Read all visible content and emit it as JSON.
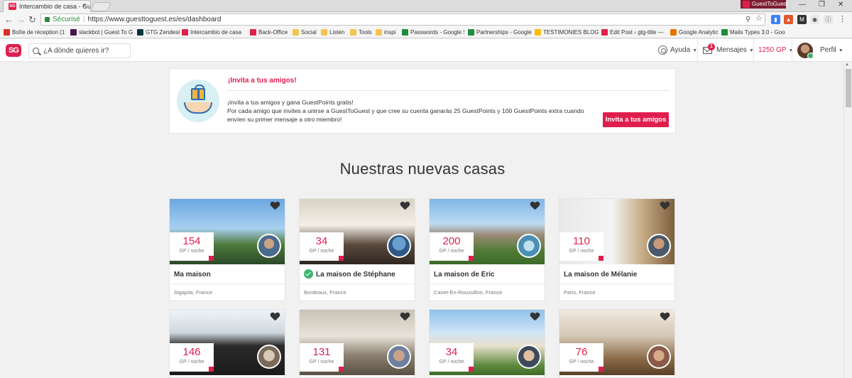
{
  "browser": {
    "tab_title": "Intercambio de casa - Gu",
    "tab_favicon": "SG",
    "profile_name": "GuestToGuest",
    "secure_label": "Sécurisé",
    "url": "https://www.guesttoguest.es/es/dashboard",
    "bookmarks": [
      {
        "label": "Boîte de réception (1",
        "icon": "gmail-icon",
        "color": "#d93025"
      },
      {
        "label": "slackbot | Guest To G",
        "icon": "slack-icon",
        "color": "#4a154b"
      },
      {
        "label": "GTG Zendesk",
        "icon": "zendesk-icon",
        "color": "#03363d"
      },
      {
        "label": "Intercambio de casa",
        "icon": "guesttoguest-icon",
        "color": "#e01e4e"
      },
      {
        "label": "Back-Office",
        "icon": "guesttoguest-icon",
        "color": "#e01e4e"
      },
      {
        "label": "Social",
        "icon": "folder-icon",
        "color": "#f3c44f"
      },
      {
        "label": "Listen",
        "icon": "folder-icon",
        "color": "#f3c44f"
      },
      {
        "label": "Tools",
        "icon": "folder-icon",
        "color": "#f3c44f"
      },
      {
        "label": "inspi",
        "icon": "folder-icon",
        "color": "#f3c44f"
      },
      {
        "label": "Passwords - Google S",
        "icon": "sheets-icon",
        "color": "#1e8e3e"
      },
      {
        "label": "Partnerships - Google",
        "icon": "sheets-icon",
        "color": "#1e8e3e"
      },
      {
        "label": "TESTIMONIES BLOG",
        "icon": "drive-icon",
        "color": "#fbbc04"
      },
      {
        "label": "Edit Post ‹ gtg-title —",
        "icon": "guesttoguest-icon",
        "color": "#e01e4e"
      },
      {
        "label": "Google Analytics",
        "icon": "analytics-icon",
        "color": "#e37400"
      },
      {
        "label": "Mails Types 3.0 - Goo",
        "icon": "sheets-icon",
        "color": "#1e8e3e"
      }
    ]
  },
  "header": {
    "logo_text": "SG",
    "search_placeholder": "¿A dónde quieres ir?",
    "help_label": "Ayuda",
    "messages_label": "Mensajes",
    "messages_badge": "1",
    "gp_balance": "1250 GP",
    "profile_label": "Perfil"
  },
  "invite": {
    "title": "¡Invita a tus amigos!",
    "line1": "¡Invita a tus amigos y gana GuestPoints gratis!",
    "line2": "Por cada amigo que invites a unirse a GuestToGuest y que cree su cuenta ganarás 25 GuestPoints y 100 GuestPoints extra cuando envíen su primer mensaje a otro miembro!",
    "button_label": "Invita a tus amigos"
  },
  "section_title": "Nuestras nuevas casas",
  "listings": [
    {
      "price": "154",
      "unit": "GP / noche",
      "title": "Ma maison",
      "location": "Algajola, France",
      "verified": false
    },
    {
      "price": "34",
      "unit": "GP / noche",
      "title": "La maison de Stéphane",
      "location": "Bordeaux, France",
      "verified": true
    },
    {
      "price": "200",
      "unit": "GP / noche",
      "title": "La maison de Eric",
      "location": "Canet-En-Roussillon, France",
      "verified": false
    },
    {
      "price": "110",
      "unit": "GP / noche",
      "title": "La maison de Mélanie",
      "location": "Paris, France",
      "verified": false
    },
    {
      "price": "146",
      "unit": "GP / noche",
      "title": "",
      "location": "",
      "verified": false
    },
    {
      "price": "131",
      "unit": "GP / noche",
      "title": "",
      "location": "",
      "verified": false
    },
    {
      "price": "34",
      "unit": "GP / noche",
      "title": "",
      "location": "",
      "verified": false
    },
    {
      "price": "76",
      "unit": "GP / noche",
      "title": "",
      "location": "",
      "verified": false
    }
  ],
  "colors": {
    "brand": "#e01e4e",
    "verified": "#3cb371"
  }
}
